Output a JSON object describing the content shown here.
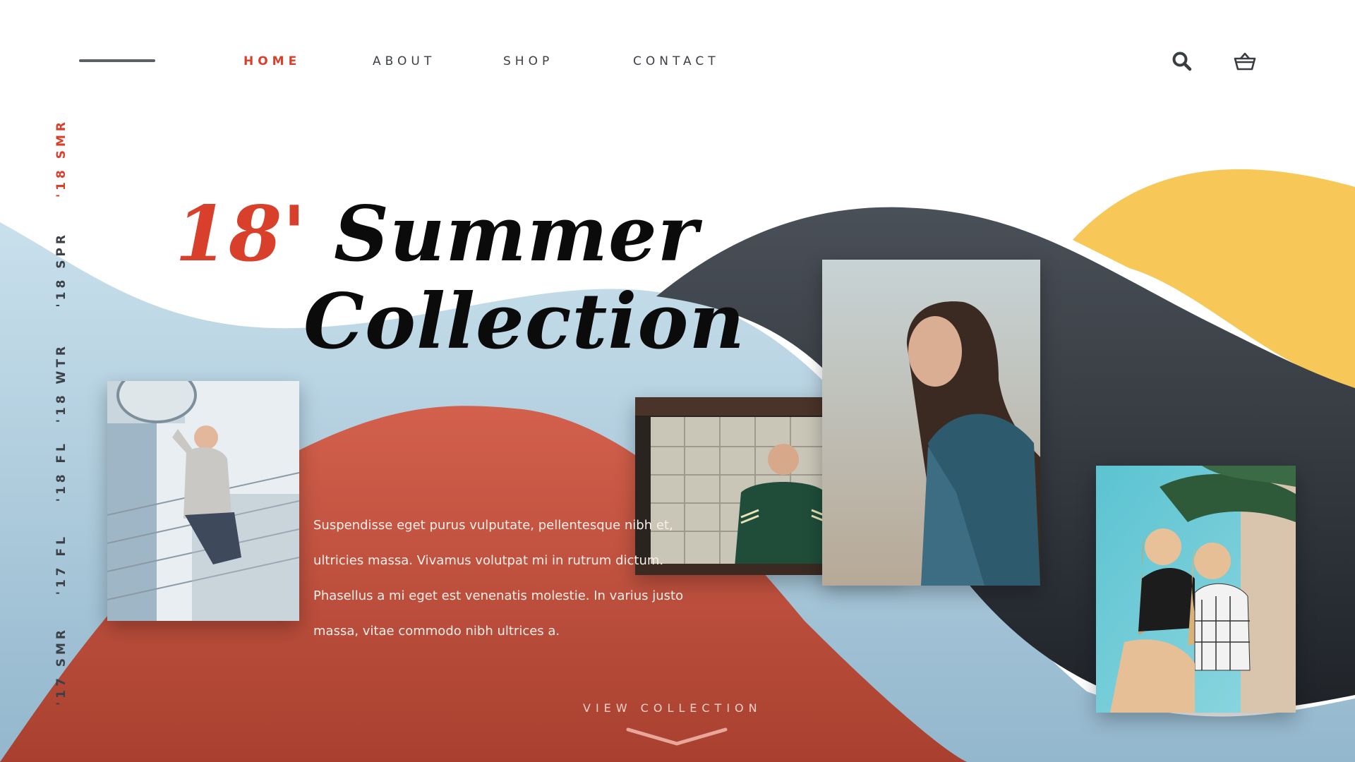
{
  "theme": {
    "accent": "#d9402b",
    "text_dark": "#3c3f44",
    "wave_light_blue": "#b9d5e4",
    "wave_dark": "#3e454d",
    "wave_yellow": "#f7c758",
    "wave_red": "#c65443"
  },
  "header": {
    "menu_icon": "hamburger-line-icon",
    "nav": [
      {
        "label": "HOME",
        "active": true
      },
      {
        "label": "ABOUT",
        "active": false
      },
      {
        "label": "SHOP",
        "active": false
      },
      {
        "label": "CONTACT",
        "active": false
      }
    ],
    "search_icon": "search-icon",
    "cart_icon": "basket-icon"
  },
  "sidebar": {
    "seasons": [
      {
        "label": "'18 SMR",
        "active": true
      },
      {
        "label": "'18 SPR",
        "active": false
      },
      {
        "label": "'18 WTR",
        "active": false
      },
      {
        "label": "'18 FL",
        "active": false
      },
      {
        "label": "'17 FL",
        "active": false
      },
      {
        "label": "'17 SMR",
        "active": false
      }
    ]
  },
  "hero": {
    "year": "18'",
    "title_line1": "Summer",
    "title_line2": "Collection",
    "body": "Suspendisse eget purus vulputate, pellentesque nibh et, ultricies massa. Vivamus volutpat mi in rutrum dictum. Phasellus a mi eget est venenatis molestie. In varius justo massa, vitae commodo nibh ultrices a.",
    "cta": "VIEW COLLECTION",
    "cta_icon": "chevron-down-icon"
  }
}
